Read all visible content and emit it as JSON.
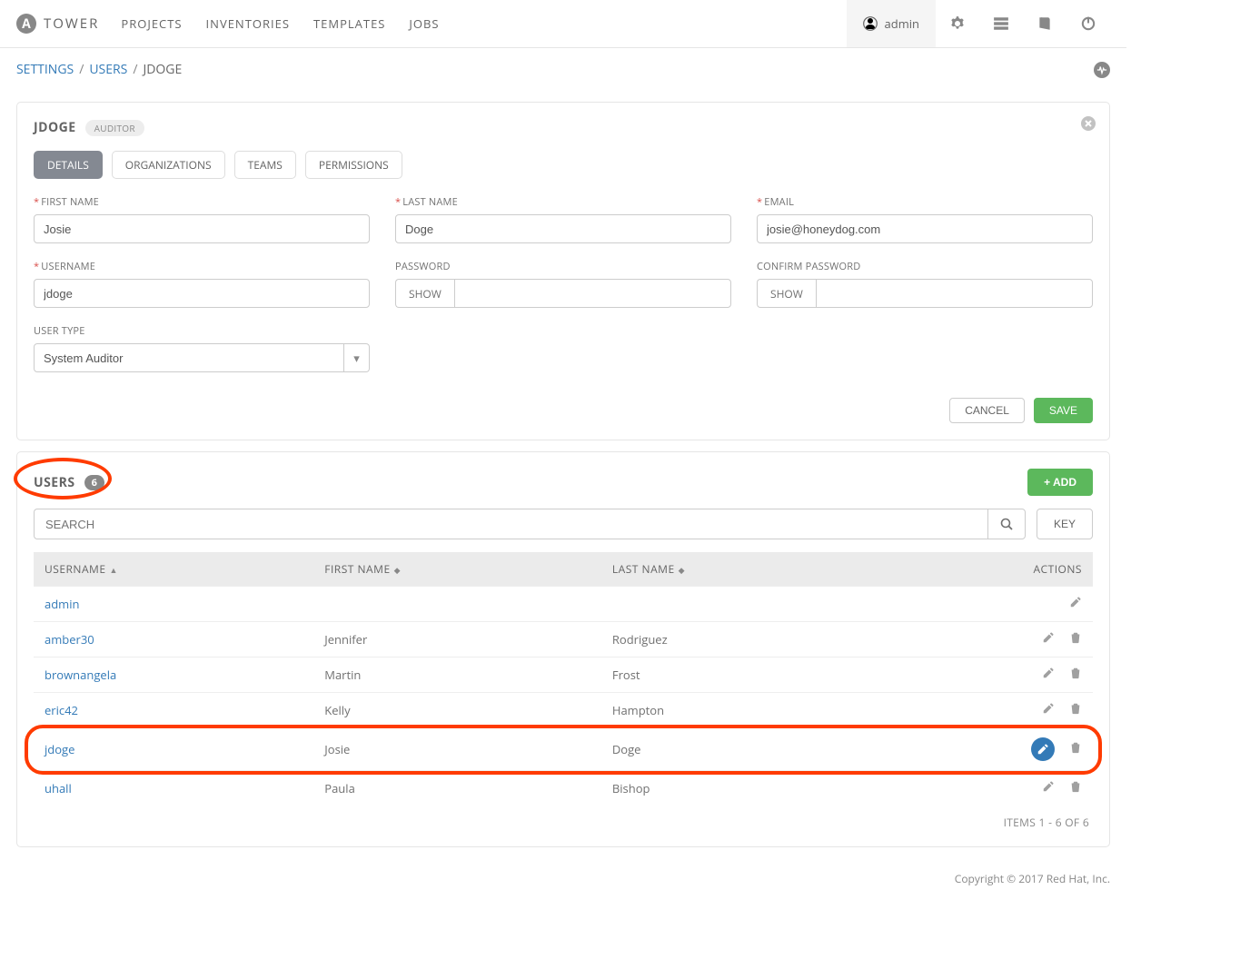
{
  "brand": "TOWER",
  "nav": [
    "PROJECTS",
    "INVENTORIES",
    "TEMPLATES",
    "JOBS"
  ],
  "user": "admin",
  "breadcrumb": {
    "a": "SETTINGS",
    "b": "USERS",
    "c": "JDOGE",
    "sep": "/"
  },
  "detail": {
    "title": "JDOGE",
    "role": "AUDITOR",
    "tabs": [
      "DETAILS",
      "ORGANIZATIONS",
      "TEAMS",
      "PERMISSIONS"
    ],
    "labels": {
      "first_name": "FIRST NAME",
      "last_name": "LAST NAME",
      "email": "EMAIL",
      "username": "USERNAME",
      "password": "PASSWORD",
      "confirm": "CONFIRM PASSWORD",
      "user_type": "USER TYPE"
    },
    "values": {
      "first_name": "Josie",
      "last_name": "Doge",
      "email": "josie@honeydog.com",
      "username": "jdoge",
      "user_type": "System Auditor"
    },
    "show": "SHOW",
    "cancel": "CANCEL",
    "save": "SAVE"
  },
  "list": {
    "title": "USERS",
    "count": "6",
    "add": "+ ADD",
    "search_ph": "SEARCH",
    "key": "KEY",
    "cols": {
      "username": "USERNAME",
      "first": "FIRST NAME",
      "last": "LAST NAME",
      "actions": "ACTIONS"
    },
    "rows": [
      {
        "u": "admin",
        "f": "",
        "l": "",
        "del": false,
        "active": false
      },
      {
        "u": "amber30",
        "f": "Jennifer",
        "l": "Rodriguez",
        "del": true,
        "active": false
      },
      {
        "u": "brownangela",
        "f": "Martin",
        "l": "Frost",
        "del": true,
        "active": false
      },
      {
        "u": "eric42",
        "f": "Kelly",
        "l": "Hampton",
        "del": true,
        "active": false
      },
      {
        "u": "jdoge",
        "f": "Josie",
        "l": "Doge",
        "del": true,
        "active": true
      },
      {
        "u": "uhall",
        "f": "Paula",
        "l": "Bishop",
        "del": true,
        "active": false
      }
    ],
    "pager": "ITEMS  1 - 6 OF 6"
  },
  "footer": "Copyright © 2017 Red Hat, Inc."
}
